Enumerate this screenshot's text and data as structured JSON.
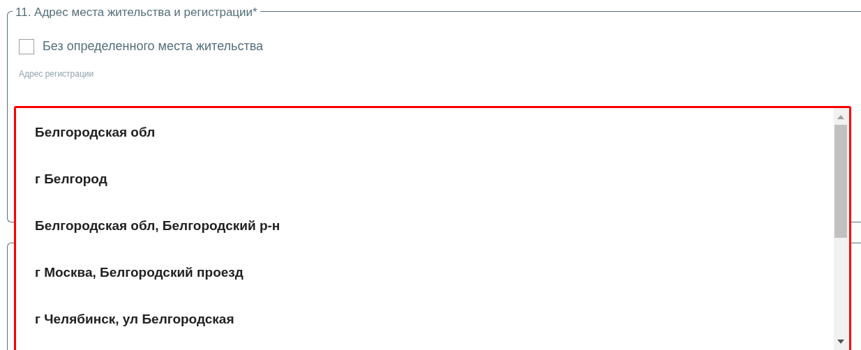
{
  "section": {
    "legend": "11. Адрес места жительства и регистрации*"
  },
  "checkbox": {
    "label": "Без определенного места жительства",
    "checked": false
  },
  "address_field": {
    "label": "Адрес регистрации"
  },
  "suggestions": [
    {
      "text": "Белгородская обл"
    },
    {
      "text": "г Белгород"
    },
    {
      "text": "Белгородская обл, Белгородский р-н"
    },
    {
      "text": "г Москва, Белгородский проезд"
    },
    {
      "text": "г Челябинск, ул Белгородская"
    }
  ]
}
